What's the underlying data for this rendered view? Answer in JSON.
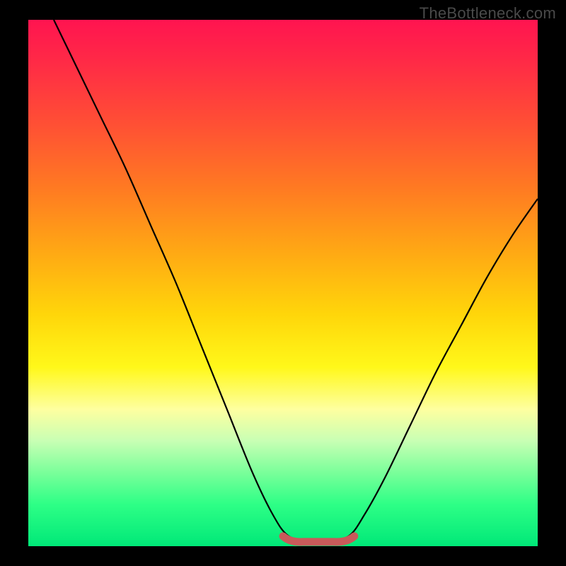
{
  "watermark": "TheBottleneck.com",
  "chart_data": {
    "type": "line",
    "title": "",
    "xlabel": "",
    "ylabel": "",
    "xlim": [
      0,
      100
    ],
    "ylim": [
      0,
      100
    ],
    "grid": false,
    "legend": false,
    "curve_points": [
      {
        "x": 5,
        "y": 100
      },
      {
        "x": 9,
        "y": 92
      },
      {
        "x": 14,
        "y": 82
      },
      {
        "x": 19,
        "y": 72
      },
      {
        "x": 24,
        "y": 61
      },
      {
        "x": 29,
        "y": 50
      },
      {
        "x": 34,
        "y": 38
      },
      {
        "x": 39,
        "y": 26
      },
      {
        "x": 44,
        "y": 14
      },
      {
        "x": 48,
        "y": 6
      },
      {
        "x": 51,
        "y": 2
      },
      {
        "x": 55,
        "y": 1
      },
      {
        "x": 59,
        "y": 1
      },
      {
        "x": 63,
        "y": 2
      },
      {
        "x": 66,
        "y": 6
      },
      {
        "x": 70,
        "y": 13
      },
      {
        "x": 75,
        "y": 23
      },
      {
        "x": 80,
        "y": 33
      },
      {
        "x": 85,
        "y": 42
      },
      {
        "x": 90,
        "y": 51
      },
      {
        "x": 95,
        "y": 59
      },
      {
        "x": 100,
        "y": 66
      }
    ],
    "highlight_region": {
      "color": "#c85a5a",
      "x_start": 50,
      "x_end": 64,
      "y_approx": 1.5
    }
  }
}
